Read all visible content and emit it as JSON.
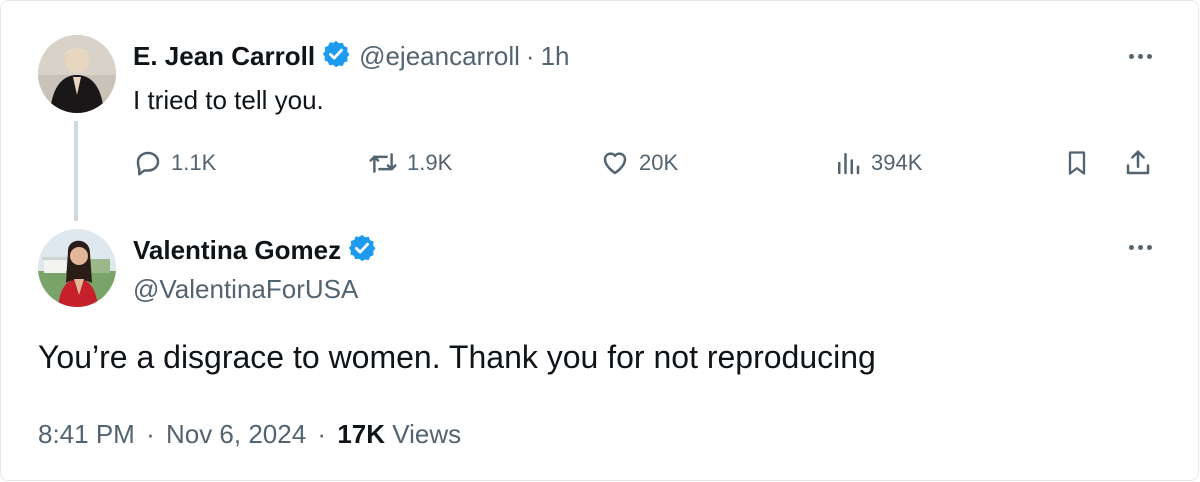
{
  "parent_tweet": {
    "author_name": "E. Jean Carroll",
    "handle": "@ejeancarroll",
    "separator": "·",
    "time_ago": "1h",
    "text": "I tried to tell you.",
    "actions": {
      "replies": "1.1K",
      "reposts": "1.9K",
      "likes": "20K",
      "views": "394K"
    }
  },
  "reply_tweet": {
    "author_name": "Valentina Gomez",
    "handle": "@ValentinaForUSA",
    "text": "You’re a disgrace to women. Thank you for not reproducing",
    "time": "8:41 PM",
    "sep1": "·",
    "date": "Nov 6, 2024",
    "sep2": "·",
    "views_count": "17K",
    "views_label": "Views"
  },
  "colors": {
    "verified_badge": "#1d9bf0",
    "text_primary": "#0f1419",
    "text_secondary": "#536471",
    "thread_line": "#cfd9de"
  },
  "icons": [
    "verified-icon",
    "more-icon",
    "reply-icon",
    "repost-icon",
    "like-icon",
    "views-icon",
    "bookmark-icon",
    "share-icon"
  ]
}
